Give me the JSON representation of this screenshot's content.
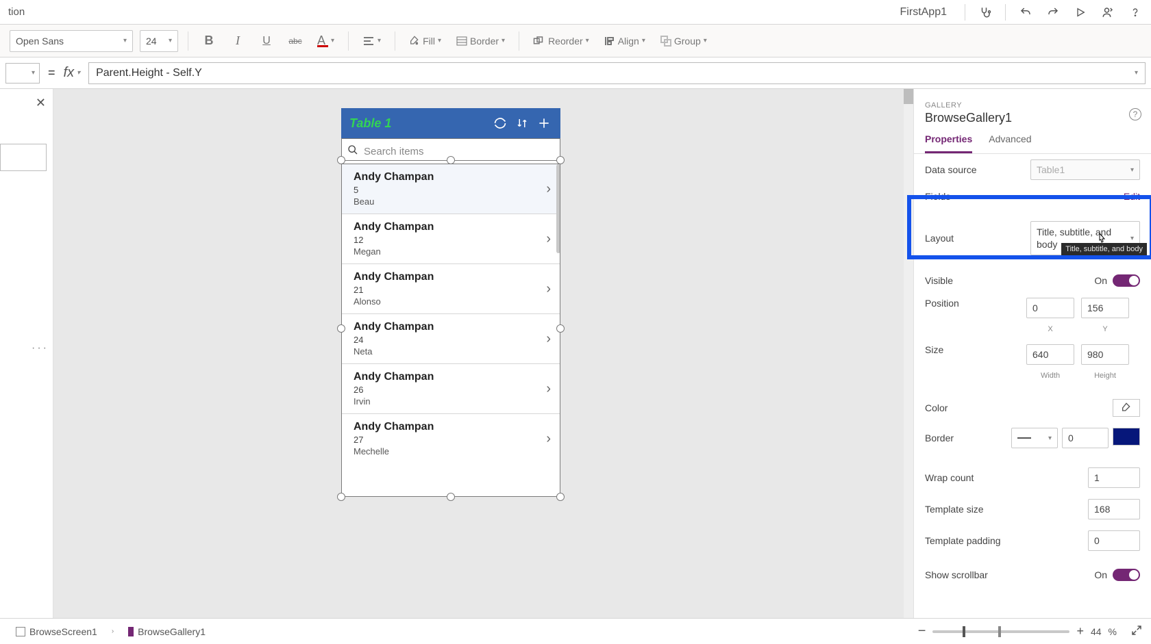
{
  "titlebar": {
    "left": "tion",
    "app": "FirstApp1"
  },
  "ribbon": {
    "font": "Open Sans",
    "size": "24",
    "fill": "Fill",
    "border": "Border",
    "reorder": "Reorder",
    "align": "Align",
    "group": "Group"
  },
  "formula": {
    "eq": "=",
    "fx": "fx",
    "expr": "Parent.Height - Self.Y"
  },
  "phone": {
    "title": "Table 1",
    "search_placeholder": "Search items",
    "rows": [
      {
        "t1": "Andy Champan",
        "t2": "5",
        "t3": "Beau"
      },
      {
        "t1": "Andy Champan",
        "t2": "12",
        "t3": "Megan"
      },
      {
        "t1": "Andy Champan",
        "t2": "21",
        "t3": "Alonso"
      },
      {
        "t1": "Andy Champan",
        "t2": "24",
        "t3": "Neta"
      },
      {
        "t1": "Andy Champan",
        "t2": "26",
        "t3": "Irvin"
      },
      {
        "t1": "Andy Champan",
        "t2": "27",
        "t3": "Mechelle"
      }
    ]
  },
  "props": {
    "eyebrow": "GALLERY",
    "name": "BrowseGallery1",
    "tabs": {
      "properties": "Properties",
      "advanced": "Advanced"
    },
    "datasource_label": "Data source",
    "datasource_value": "Table1",
    "fields_label": "Fields",
    "fields_action": "Edit",
    "layout_label": "Layout",
    "layout_value": "Title, subtitle, and body",
    "layout_tooltip": "Title, subtitle, and body",
    "visible_label": "Visible",
    "visible_value": "On",
    "position_label": "Position",
    "x": "0",
    "y": "156",
    "xlabel": "X",
    "ylabel": "Y",
    "size_label": "Size",
    "w": "640",
    "h": "980",
    "wlabel": "Width",
    "hlabel": "Height",
    "color_label": "Color",
    "border_label": "Border",
    "border_width": "0",
    "wrap_label": "Wrap count",
    "wrap_value": "1",
    "template_size_label": "Template size",
    "template_size_value": "168",
    "template_pad_label": "Template padding",
    "template_pad_value": "0",
    "scroll_label": "Show scrollbar",
    "scroll_value": "On"
  },
  "status": {
    "crumb1": "BrowseScreen1",
    "crumb2": "BrowseGallery1",
    "zoom": "44",
    "zoom_suffix": "%"
  }
}
